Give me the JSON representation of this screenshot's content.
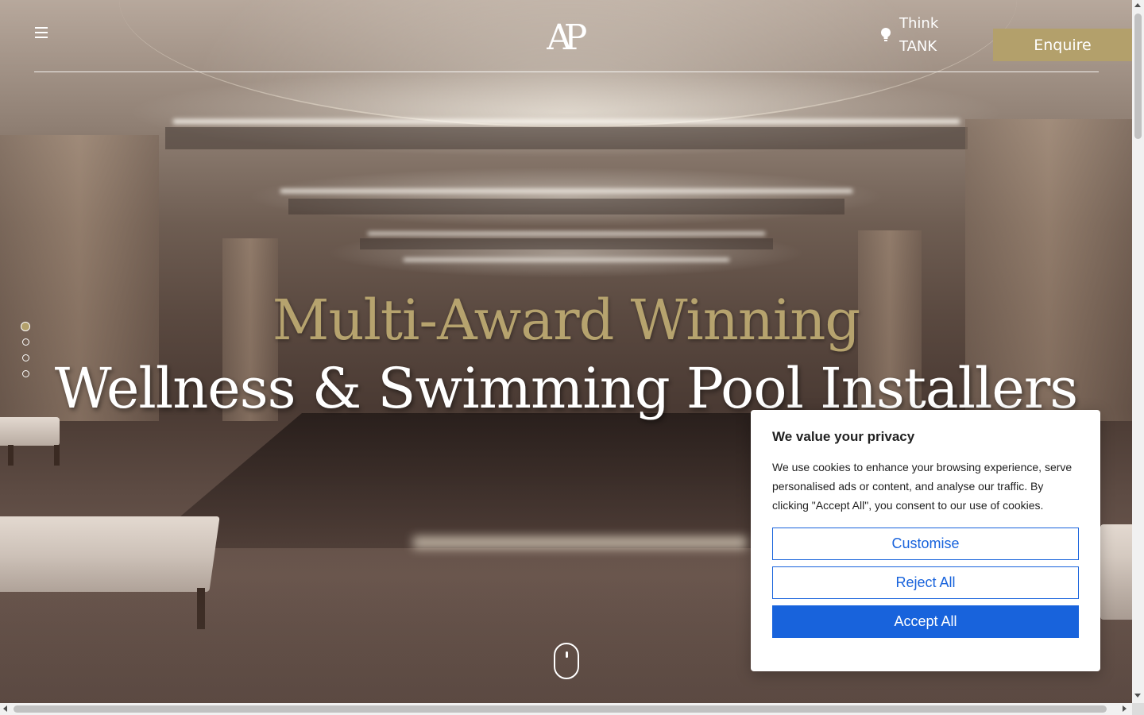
{
  "header": {
    "logo_text": "AP",
    "think_tank": {
      "line1": "Think",
      "line2": "TANK"
    },
    "enquire_label": "Enquire"
  },
  "hero": {
    "headline_top": "Multi-Award Winning",
    "headline_main": "Wellness & Swimming Pool Installers",
    "slides_count": 4,
    "active_slide": 1
  },
  "cookie_banner": {
    "title": "We value your privacy",
    "body": "We use cookies to enhance your browsing experience, serve personalised ads or content, and analyse our traffic. By clicking \"Accept All\", you consent to our use of cookies.",
    "customise_label": "Customise",
    "reject_label": "Reject All",
    "accept_label": "Accept All"
  },
  "colors": {
    "gold": "#b3a06b",
    "cookie_blue": "#1863dc"
  },
  "icons": [
    "menu-icon",
    "lightbulb-icon",
    "mouse-scroll-icon"
  ]
}
